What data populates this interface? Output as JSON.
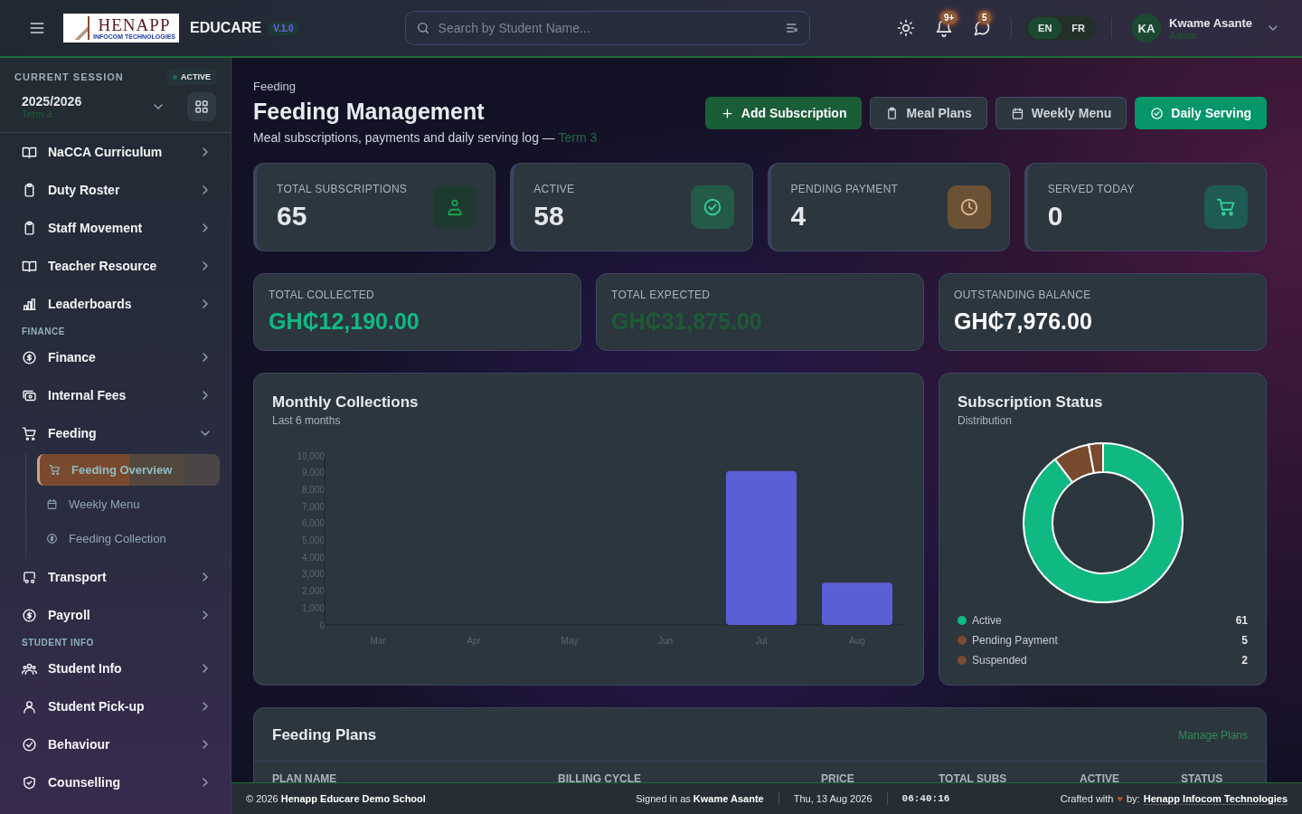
{
  "header": {
    "logo": {
      "wordmark": "HENAPP",
      "tagline": "INFOCOM TECHNOLOGIES"
    },
    "app_name": "EDUCARE",
    "version": "V.1.0",
    "search": {
      "placeholder": "Search by Student Name..."
    },
    "notifications_badge": "9+",
    "messages_badge": "5",
    "languages": [
      {
        "label": "EN",
        "selected": true
      },
      {
        "label": "FR",
        "selected": false
      }
    ],
    "user": {
      "initials": "KA",
      "name": "Kwame Asante",
      "role": "Admin"
    }
  },
  "sidebar": {
    "session": {
      "label": "CURRENT SESSION",
      "status": "ACTIVE",
      "year": "2025/2026",
      "term": "Term 3"
    },
    "items": [
      {
        "kind": "item",
        "label": "NaCCA Curriculum",
        "expanded": false
      },
      {
        "kind": "item",
        "label": "Duty Roster",
        "expanded": false
      },
      {
        "kind": "item",
        "label": "Staff Movement",
        "expanded": false
      },
      {
        "kind": "item",
        "label": "Teacher Resource",
        "expanded": false
      },
      {
        "kind": "item",
        "label": "Leaderboards",
        "expanded": false
      },
      {
        "kind": "section",
        "label": "FINANCE"
      },
      {
        "kind": "item",
        "label": "Finance",
        "expanded": false
      },
      {
        "kind": "item",
        "label": "Internal Fees",
        "expanded": false
      },
      {
        "kind": "item",
        "label": "Feeding",
        "expanded": true,
        "children": [
          {
            "label": "Feeding Overview",
            "selected": true
          },
          {
            "label": "Weekly Menu",
            "selected": false
          },
          {
            "label": "Feeding Collection",
            "selected": false
          }
        ]
      },
      {
        "kind": "item",
        "label": "Transport",
        "expanded": false
      },
      {
        "kind": "item",
        "label": "Payroll",
        "expanded": false
      },
      {
        "kind": "section",
        "label": "STUDENT INFO"
      },
      {
        "kind": "item",
        "label": "Student Info",
        "expanded": false
      },
      {
        "kind": "item",
        "label": "Student Pick-up",
        "expanded": false
      },
      {
        "kind": "item",
        "label": "Behaviour",
        "expanded": false
      },
      {
        "kind": "item",
        "label": "Counselling",
        "expanded": false
      }
    ]
  },
  "page": {
    "breadcrumb": "Feeding",
    "title": "Feeding Management",
    "subtitle": "Meal subscriptions, payments and daily serving log —",
    "subtitle_term": "Term 3",
    "actions": [
      {
        "label": "Add Subscription",
        "kind": "primary"
      },
      {
        "label": "Meal Plans",
        "kind": "outline"
      },
      {
        "label": "Weekly Menu",
        "kind": "outline"
      },
      {
        "label": "Daily Serving",
        "kind": "accent"
      }
    ]
  },
  "stats": [
    {
      "label": "TOTAL SUBSCRIPTIONS",
      "value": "65",
      "color": "#1e3a30"
    },
    {
      "label": "ACTIVE",
      "value": "58",
      "color": "#235a48"
    },
    {
      "label": "PENDING PAYMENT",
      "value": "4",
      "color": "#6b5236"
    },
    {
      "label": "SERVED TODAY",
      "value": "0",
      "color": "#1f5a55"
    }
  ],
  "money": [
    {
      "label": "TOTAL COLLECTED",
      "value": "GH₵12,190.00",
      "color": "#10b981"
    },
    {
      "label": "TOTAL EXPECTED",
      "value": "GH₵31,875.00",
      "color": "#1c5a36"
    },
    {
      "label": "OUTSTANDING BALANCE",
      "value": "GH₵7,976.00",
      "color": "#ffffff"
    }
  ],
  "monthly_collections": {
    "title": "Monthly Collections",
    "subtitle": "Last 6 months",
    "chart_data": {
      "type": "bar",
      "categories": [
        "Mar",
        "Apr",
        "May",
        "Jun",
        "Jul",
        "Aug"
      ],
      "series": [
        {
          "color": "#5b5fd6",
          "values": [
            0,
            0,
            0,
            0,
            9100,
            2500
          ]
        }
      ],
      "ylim": [
        0,
        10000
      ],
      "yticks": [
        {
          "value": 0,
          "label": "0"
        },
        {
          "value": 1000,
          "label": "1,000"
        },
        {
          "value": 2000,
          "label": "2,000"
        },
        {
          "value": 3000,
          "label": "3,000"
        },
        {
          "value": 4000,
          "label": "4,000"
        },
        {
          "value": 5000,
          "label": "5,000"
        },
        {
          "value": 6000,
          "label": "6,000"
        },
        {
          "value": 7000,
          "label": "7,000"
        },
        {
          "value": 8000,
          "label": "8,000"
        },
        {
          "value": 9000,
          "label": "9,000"
        },
        {
          "value": 10000,
          "label": "10,000"
        }
      ]
    }
  },
  "subscription_status": {
    "title": "Subscription Status",
    "subtitle": "Distribution",
    "chart_data": {
      "type": "donut",
      "categories": [
        "Active",
        "Pending Payment",
        "Suspended"
      ],
      "series": [
        {
          "values": [
            89.7,
            7.4,
            2.9
          ]
        }
      ],
      "colors": [
        "#10b981",
        "#7a4a2e",
        "#7a4a2e"
      ],
      "legend": "bottom"
    },
    "legend_values": [
      "61",
      "5",
      "2"
    ]
  },
  "feeding_plans": {
    "title": "Feeding Plans",
    "link": "Manage Plans",
    "columns": [
      "PLAN NAME",
      "BILLING CYCLE",
      "PRICE",
      "TOTAL SUBS",
      "ACTIVE",
      "STATUS"
    ]
  },
  "footer": {
    "copyright": "© 2026 **Henapp Educare Demo School**",
    "signed_in": "Signed in as **Kwame Asante**",
    "date": "Thu, 13 Aug 2026",
    "time": "06:40:16",
    "credit_prefix": "Crafted with",
    "heart": "♥",
    "credit_by": "by:",
    "credit_company": "Henapp Infocom Technologies"
  }
}
